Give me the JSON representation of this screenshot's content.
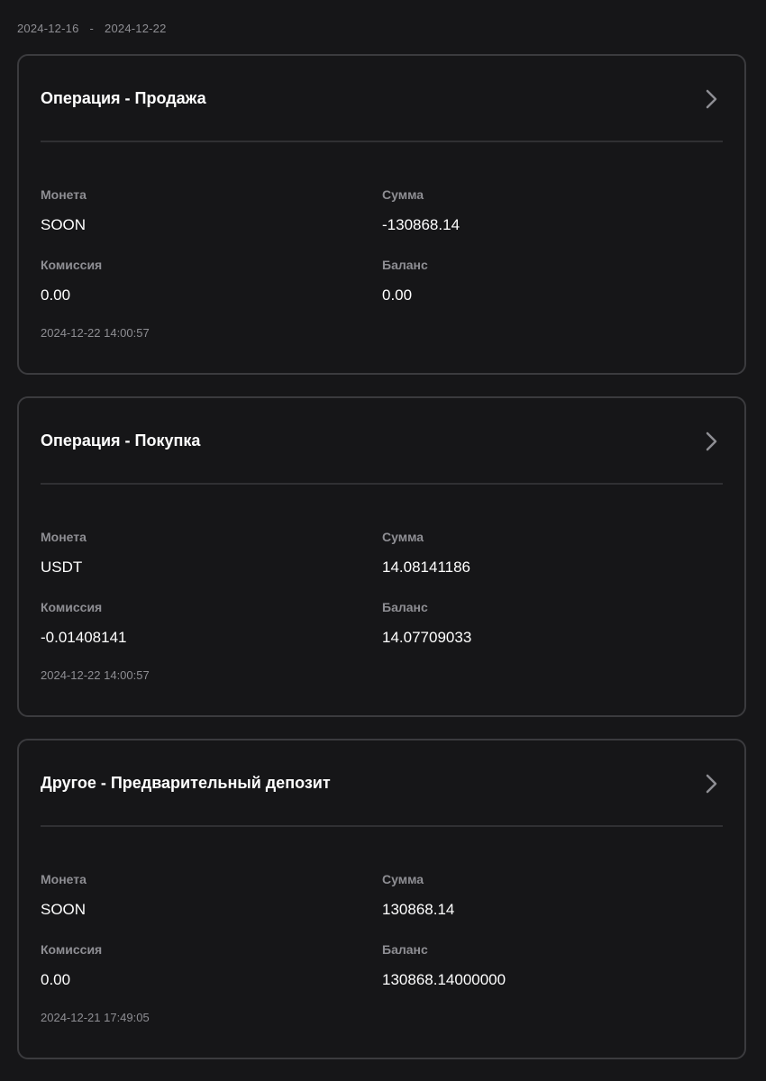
{
  "date_range": {
    "start": "2024-12-16",
    "separator": "-",
    "end": "2024-12-22"
  },
  "labels": {
    "coin": "Монета",
    "amount": "Сумма",
    "fee": "Комиссия",
    "balance": "Баланс"
  },
  "transactions": [
    {
      "title": "Операция - Продажа",
      "coin": "SOON",
      "amount": "-130868.14",
      "fee": "0.00",
      "balance": "0.00",
      "timestamp": "2024-12-22 14:00:57"
    },
    {
      "title": "Операция - Покупка",
      "coin": "USDT",
      "amount": "14.08141186",
      "fee": "-0.01408141",
      "balance": "14.07709033",
      "timestamp": "2024-12-22 14:00:57"
    },
    {
      "title": "Другое - Предварительный депозит",
      "coin": "SOON",
      "amount": "130868.14",
      "fee": "0.00",
      "balance": "130868.14000000",
      "timestamp": "2024-12-21 17:49:05"
    }
  ],
  "icons": {
    "chevron": "chevron-right-icon"
  },
  "colors": {
    "background": "#161618",
    "card_border": "#3b3b3e",
    "muted_text": "#8e8e93"
  }
}
